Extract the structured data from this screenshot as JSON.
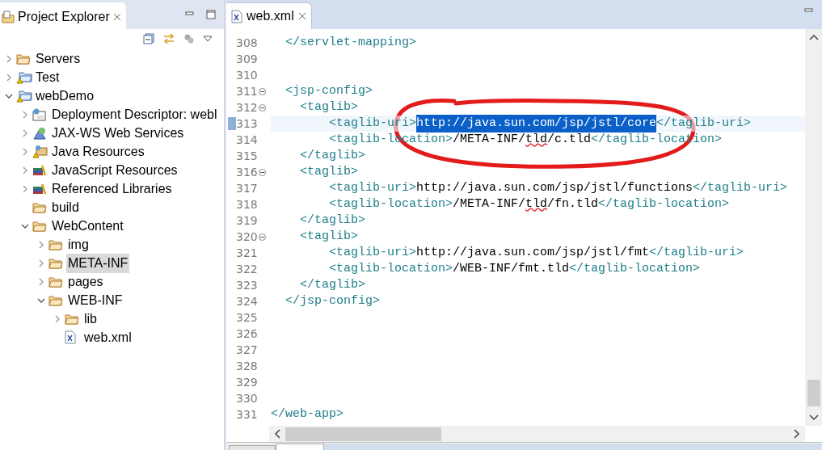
{
  "explorer": {
    "title": "Project Explorer",
    "tree": [
      {
        "label": "Servers",
        "kind": "folder",
        "expanded": false,
        "selected": false
      },
      {
        "label": "Test",
        "kind": "project",
        "expanded": false,
        "selected": false
      },
      {
        "label": "webDemo",
        "kind": "project",
        "expanded": true,
        "selected": false,
        "children": [
          {
            "label": "Deployment Descriptor: webl",
            "kind": "descriptor",
            "expanded": false,
            "selected": false
          },
          {
            "label": "JAX-WS Web Services",
            "kind": "services",
            "expanded": false,
            "selected": false
          },
          {
            "label": "Java Resources",
            "kind": "javares",
            "expanded": false,
            "selected": false
          },
          {
            "label": "JavaScript Resources",
            "kind": "library",
            "expanded": false,
            "selected": false
          },
          {
            "label": "Referenced Libraries",
            "kind": "library",
            "expanded": false,
            "selected": false
          },
          {
            "label": "build",
            "kind": "folder",
            "selected": false
          },
          {
            "label": "WebContent",
            "kind": "folder",
            "expanded": true,
            "selected": false,
            "children": [
              {
                "label": "img",
                "kind": "folder",
                "expanded": false,
                "selected": false
              },
              {
                "label": "META-INF",
                "kind": "folder",
                "expanded": false,
                "selected": true
              },
              {
                "label": "pages",
                "kind": "folder",
                "expanded": false,
                "selected": false
              },
              {
                "label": "WEB-INF",
                "kind": "folder",
                "expanded": true,
                "selected": false,
                "children": [
                  {
                    "label": "lib",
                    "kind": "folder",
                    "expanded": false,
                    "selected": false
                  },
                  {
                    "label": "web.xml",
                    "kind": "xml",
                    "selected": false
                  }
                ]
              }
            ]
          }
        ]
      }
    ]
  },
  "editor": {
    "tab": "web.xml",
    "lines": [
      {
        "number": "308",
        "segments": [
          {
            "kind": "tag",
            "text": "  </servlet-mapping>"
          }
        ]
      },
      {
        "number": "309"
      },
      {
        "number": "310"
      },
      {
        "number": "311",
        "foldable": true,
        "segments": [
          {
            "kind": "tag",
            "text": "  <jsp-config>"
          }
        ]
      },
      {
        "number": "312",
        "foldable": true,
        "segments": [
          {
            "kind": "tag",
            "text": "    <taglib>"
          }
        ]
      },
      {
        "number": "313",
        "current": true,
        "segments": [
          {
            "kind": "tag",
            "text": "        <taglib-uri>"
          },
          {
            "kind": "selected",
            "text": "http://java.sun.com/jsp/jstl/core"
          },
          {
            "kind": "tag",
            "text": "</taglib-uri>"
          }
        ]
      },
      {
        "number": "314",
        "segments": [
          {
            "kind": "tag",
            "text": "        <taglib-location>"
          },
          {
            "kind": "text",
            "text": "/META-INF/"
          },
          {
            "kind": "misspelled",
            "text": "tld"
          },
          {
            "kind": "text",
            "text": "/c.tld"
          },
          {
            "kind": "tag",
            "text": "</taglib-location>"
          }
        ]
      },
      {
        "number": "315",
        "segments": [
          {
            "kind": "tag",
            "text": "    </taglib>"
          }
        ]
      },
      {
        "number": "316",
        "foldable": true,
        "segments": [
          {
            "kind": "tag",
            "text": "    <taglib>"
          }
        ]
      },
      {
        "number": "317",
        "segments": [
          {
            "kind": "tag",
            "text": "        <taglib-uri>"
          },
          {
            "kind": "text",
            "text": "http://java.sun.com/jsp/jstl/functions"
          },
          {
            "kind": "tag",
            "text": "</taglib-uri>"
          }
        ]
      },
      {
        "number": "318",
        "segments": [
          {
            "kind": "tag",
            "text": "        <taglib-location>"
          },
          {
            "kind": "text",
            "text": "/META-INF/"
          },
          {
            "kind": "misspelled",
            "text": "tld"
          },
          {
            "kind": "text",
            "text": "/fn.tld"
          },
          {
            "kind": "tag",
            "text": "</taglib-location>"
          }
        ]
      },
      {
        "number": "319",
        "segments": [
          {
            "kind": "tag",
            "text": "    </taglib>"
          }
        ]
      },
      {
        "number": "320",
        "foldable": true,
        "segments": [
          {
            "kind": "tag",
            "text": "    <taglib>"
          }
        ]
      },
      {
        "number": "321",
        "segments": [
          {
            "kind": "tag",
            "text": "        <taglib-uri>"
          },
          {
            "kind": "text",
            "text": "http://java.sun.com/jsp/jstl/fmt"
          },
          {
            "kind": "tag",
            "text": "</taglib-uri>"
          }
        ]
      },
      {
        "number": "322",
        "segments": [
          {
            "kind": "tag",
            "text": "        <taglib-location>"
          },
          {
            "kind": "text",
            "text": "/WEB-INF/fmt.tld"
          },
          {
            "kind": "tag",
            "text": "</taglib-location>"
          }
        ]
      },
      {
        "number": "323",
        "segments": [
          {
            "kind": "tag",
            "text": "    </taglib>"
          }
        ]
      },
      {
        "number": "324",
        "segments": [
          {
            "kind": "tag",
            "text": "  </jsp-config>"
          }
        ]
      },
      {
        "number": "325"
      },
      {
        "number": "326"
      },
      {
        "number": "327"
      },
      {
        "number": "328"
      },
      {
        "number": "329"
      },
      {
        "number": "330"
      },
      {
        "number": "331",
        "segments": [
          {
            "kind": "tag",
            "text": "</web-app>"
          }
        ]
      }
    ]
  }
}
